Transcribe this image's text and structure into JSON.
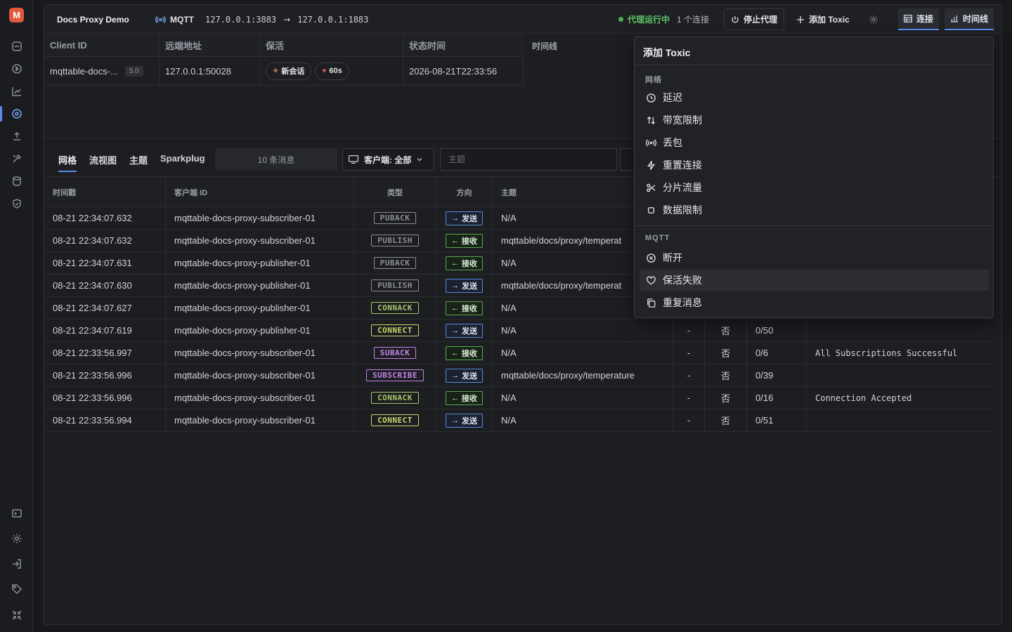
{
  "app": {
    "logo_letter": "M"
  },
  "topbar": {
    "demo_name": "Docs Proxy Demo",
    "protocol": "MQTT",
    "listen_addr": "127.0.0.1:3883",
    "arrow": "→",
    "upstream_addr": "127.0.0.1:1883",
    "status": "代理运行中",
    "status_color": "#4caf50",
    "connections": "1 个连接",
    "stop_label": "停止代理",
    "add_toxic_label": "添加 Toxic",
    "tab_connections": "连接",
    "tab_timeline": "时间线"
  },
  "clients": {
    "headers": [
      "Client ID",
      "远端地址",
      "保活",
      "状态时间"
    ],
    "row": {
      "client_id": "mqttable-docs-...",
      "version": "5.0",
      "remote": "127.0.0.1:50028",
      "session_pill": "新会话",
      "keepalive_pill": "60s",
      "state_time": "2026-08-21T22:33:56"
    }
  },
  "timeline": {
    "title": "时间线"
  },
  "lower": {
    "tabs": [
      "网格",
      "流视图",
      "主题",
      "Sparkplug"
    ],
    "msg_count": "10 条消息",
    "client_filter": "客户端: 全部",
    "topic_placeholder": "主题"
  },
  "table": {
    "headers": [
      "时间戳",
      "客户端 ID",
      "类型",
      "方向",
      "主题",
      "",
      "",
      "",
      ""
    ],
    "rows": [
      {
        "ts": "08-21 22:34:07.632",
        "client": "mqttable-docs-proxy-subscriber-01",
        "type": "PUBACK",
        "dir": "发送",
        "topic": "N/A",
        "qos": "",
        "retain": "",
        "size": "",
        "detail": ""
      },
      {
        "ts": "08-21 22:34:07.632",
        "client": "mqttable-docs-proxy-subscriber-01",
        "type": "PUBLISH",
        "dir": "接收",
        "topic": "mqttable/docs/proxy/temperat",
        "qos": "",
        "retain": "",
        "size": "",
        "detail": ""
      },
      {
        "ts": "08-21 22:34:07.631",
        "client": "mqttable-docs-proxy-publisher-01",
        "type": "PUBACK",
        "dir": "接收",
        "topic": "N/A",
        "qos": "",
        "retain": "",
        "size": "",
        "detail": ""
      },
      {
        "ts": "08-21 22:34:07.630",
        "client": "mqttable-docs-proxy-publisher-01",
        "type": "PUBLISH",
        "dir": "发送",
        "topic": "mqttable/docs/proxy/temperat",
        "qos": "",
        "retain": "",
        "size": "",
        "detail": ""
      },
      {
        "ts": "08-21 22:34:07.627",
        "client": "mqttable-docs-proxy-publisher-01",
        "type": "CONNACK",
        "dir": "接收",
        "topic": "N/A",
        "qos": "",
        "retain": "",
        "size": "",
        "detail": ""
      },
      {
        "ts": "08-21 22:34:07.619",
        "client": "mqttable-docs-proxy-publisher-01",
        "type": "CONNECT",
        "dir": "发送",
        "topic": "N/A",
        "qos": "-",
        "retain": "否",
        "size": "0/50",
        "detail": ""
      },
      {
        "ts": "08-21 22:33:56.997",
        "client": "mqttable-docs-proxy-subscriber-01",
        "type": "SUBACK",
        "dir": "接收",
        "topic": "N/A",
        "qos": "-",
        "retain": "否",
        "size": "0/6",
        "detail": "All Subscriptions Successful"
      },
      {
        "ts": "08-21 22:33:56.996",
        "client": "mqttable-docs-proxy-subscriber-01",
        "type": "SUBSCRIBE",
        "dir": "发送",
        "topic": "mqttable/docs/proxy/temperature",
        "qos": "-",
        "retain": "否",
        "size": "0/39",
        "detail": ""
      },
      {
        "ts": "08-21 22:33:56.996",
        "client": "mqttable-docs-proxy-subscriber-01",
        "type": "CONNACK",
        "dir": "接收",
        "topic": "N/A",
        "qos": "-",
        "retain": "否",
        "size": "0/16",
        "detail": "Connection Accepted"
      },
      {
        "ts": "08-21 22:33:56.994",
        "client": "mqttable-docs-proxy-subscriber-01",
        "type": "CONNECT",
        "dir": "发送",
        "topic": "N/A",
        "qos": "-",
        "retain": "否",
        "size": "0/51",
        "detail": ""
      }
    ]
  },
  "type_colors": {
    "PUBACK": "#8a8d94",
    "PUBLISH": "#8a8d94",
    "CONNACK": "#a6c66a",
    "CONNECT": "#c7d86a",
    "SUBACK": "#c084e8",
    "SUBSCRIBE": "#c084e8"
  },
  "menu": {
    "title": "添加 Toxic",
    "group_network": "网络",
    "network_items": [
      {
        "label": "延迟",
        "icon": "clock-icon"
      },
      {
        "label": "带宽限制",
        "icon": "arrows-updown-icon"
      },
      {
        "label": "丢包",
        "icon": "signal-icon"
      },
      {
        "label": "重置连接",
        "icon": "bolt-icon"
      },
      {
        "label": "分片流量",
        "icon": "scissors-icon"
      },
      {
        "label": "数据限制",
        "icon": "square-icon"
      }
    ],
    "group_mqtt": "MQTT",
    "mqtt_items": [
      {
        "label": "断开",
        "icon": "circle-x-icon"
      },
      {
        "label": "保活失败",
        "icon": "heart-icon"
      },
      {
        "label": "重复消息",
        "icon": "copy-icon"
      }
    ]
  }
}
